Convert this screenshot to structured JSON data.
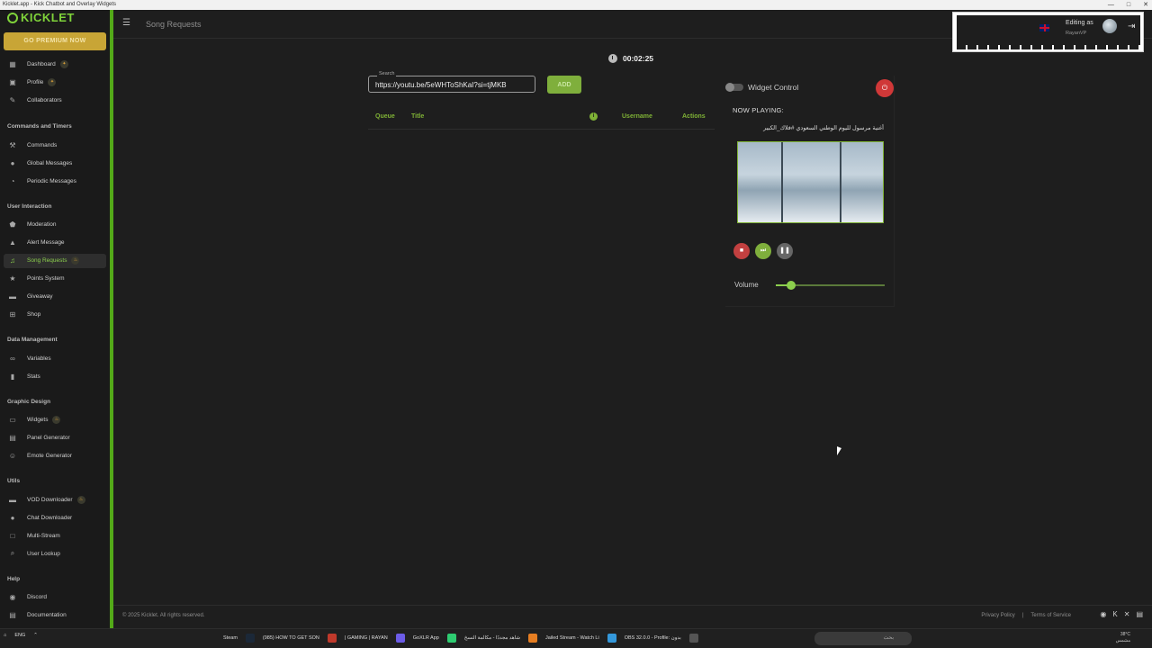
{
  "window": {
    "title": "Kicklet.app - Kick Chatbot and Overlay Widgets"
  },
  "brand": {
    "logo_text": "KICKLET",
    "premium_label": "GO PREMIUM NOW"
  },
  "sidebar": {
    "items_top": [
      {
        "label": "Dashboard",
        "icon": "dashboard-icon",
        "badge": "✦"
      },
      {
        "label": "Profile",
        "icon": "profile-icon",
        "badge": "✦"
      },
      {
        "label": "Collaborators",
        "icon": "collaborators-icon"
      }
    ],
    "sections": [
      {
        "title": "Commands and Timers",
        "items": [
          {
            "label": "Commands",
            "icon": "wrench-icon"
          },
          {
            "label": "Global Messages",
            "icon": "chat-icon"
          },
          {
            "label": "Periodic Messages",
            "icon": "clock-icon"
          }
        ]
      },
      {
        "title": "User Interaction",
        "items": [
          {
            "label": "Moderation",
            "icon": "shield-icon"
          },
          {
            "label": "Alert Message",
            "icon": "warning-icon"
          },
          {
            "label": "Song Requests",
            "icon": "music-icon",
            "badge": "♨",
            "active": true
          },
          {
            "label": "Points System",
            "icon": "star-icon"
          },
          {
            "label": "Giveaway",
            "icon": "gift-icon"
          },
          {
            "label": "Shop",
            "icon": "cart-icon"
          }
        ]
      },
      {
        "title": "Data Management",
        "items": [
          {
            "label": "Variables",
            "icon": "link-icon"
          },
          {
            "label": "Stats",
            "icon": "stats-icon"
          }
        ]
      },
      {
        "title": "Graphic Design",
        "items": [
          {
            "label": "Widgets",
            "icon": "widgets-icon",
            "badge": "♨"
          },
          {
            "label": "Panel Generator",
            "icon": "panel-icon"
          },
          {
            "label": "Emote Generator",
            "icon": "emote-icon"
          }
        ]
      },
      {
        "title": "Utils",
        "items": [
          {
            "label": "VOD Downloader",
            "icon": "film-icon",
            "badge": "♨"
          },
          {
            "label": "Chat Downloader",
            "icon": "chat-download-icon"
          },
          {
            "label": "Multi-Stream",
            "icon": "screen-icon"
          },
          {
            "label": "User Lookup",
            "icon": "search-icon"
          }
        ]
      },
      {
        "title": "Help",
        "items": [
          {
            "label": "Discord",
            "icon": "discord-icon"
          },
          {
            "label": "Documentation",
            "icon": "document-icon"
          }
        ]
      }
    ]
  },
  "header": {
    "page_title": "Song Requests"
  },
  "user": {
    "editing_as": "Editing as",
    "username": "RayanVP"
  },
  "timer": {
    "value": "00:02:25"
  },
  "search": {
    "label": "Search",
    "value": "https://youtu.be/5eWHToShKaI?si=tjMKB",
    "add_label": "ADD"
  },
  "queue_table": {
    "columns": [
      "Queue",
      "Title",
      "i",
      "Username",
      "Actions"
    ],
    "rows": []
  },
  "widget": {
    "control_label": "Widget Control",
    "control_enabled": false,
    "now_playing_label": "NOW PLAYING:",
    "song_title": "أغنية مرسول لليوم الوطني السعودي #فلاك_الكبير",
    "volume_label": "Volume",
    "volume": 0.14
  },
  "footer": {
    "copyright": "© 2025 Kicklet. All rights reserved.",
    "privacy": "Privacy Policy",
    "separator": "|",
    "terms": "Terms of Service"
  },
  "taskbar": {
    "lang": "ENG",
    "apps": [
      "Steam",
      "(985) HOW TO GET SON",
      "| GAMING | RAYAN",
      "GoXLR App",
      "شاهد مجددًا - مكالمة النسخ",
      "Jailed Stream - Watch Li",
      "OBS 32.0.0 - Profile: بدون"
    ],
    "search_placeholder": "بحث",
    "temp": "38°C",
    "weather": "مشمس"
  },
  "colors": {
    "accent": "#53a918",
    "brand_green": "#7fb236",
    "premium": "#c8a536",
    "danger": "#d03838"
  }
}
